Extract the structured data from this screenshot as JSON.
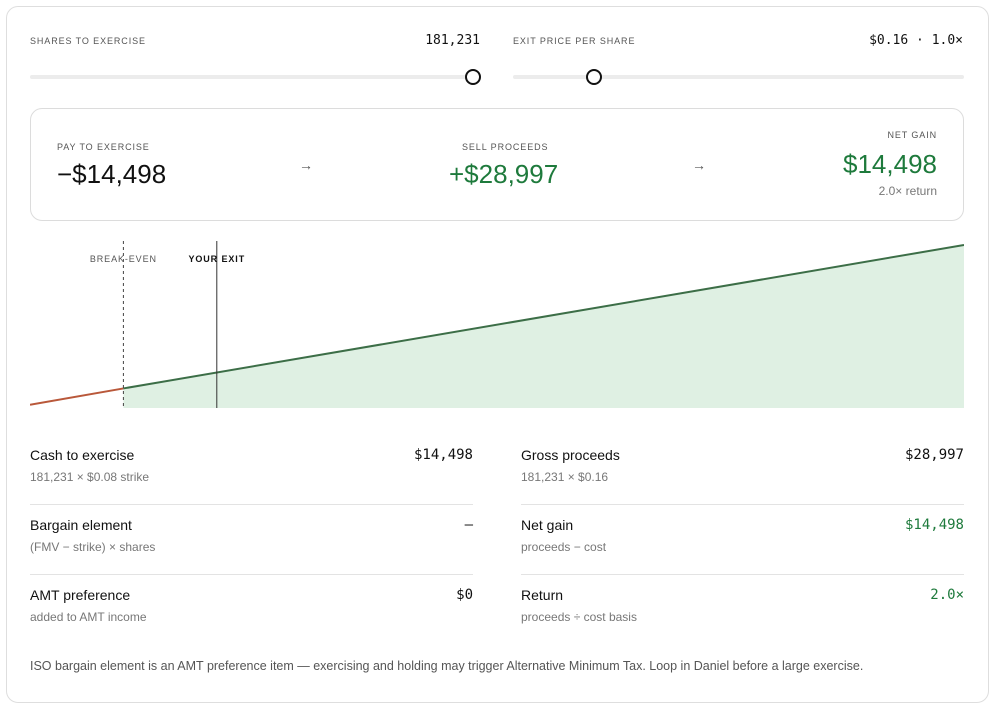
{
  "colors": {
    "accent_green": "#1e7a3c",
    "loss_red": "#b9583a",
    "area_fill": "#dff0e3",
    "line_green": "#3c6e47"
  },
  "sliders": {
    "shares": {
      "label": "SHARES TO EXERCISE",
      "value": "181,231",
      "fraction": 1.0
    },
    "exit_price": {
      "label": "EXIT PRICE PER SHARE",
      "value": "$0.16 · 1.0×",
      "fraction": 0.18
    }
  },
  "summary": {
    "pay": {
      "label": "PAY TO EXERCISE",
      "value": "−$14,498"
    },
    "sell": {
      "label": "SELL PROCEEDS",
      "value": "+$28,997"
    },
    "net": {
      "label": "NET GAIN",
      "value": "$14,498",
      "sub": "2.0× return"
    },
    "arrow_icon": "→"
  },
  "chart_data": {
    "type": "area",
    "xlim": [
      0,
      1
    ],
    "ylim": [
      0,
      1
    ],
    "series": [
      {
        "x": [
          0.0,
          0.1
        ],
        "y": [
          0.02,
          0.12
        ],
        "color": "#b9583a"
      },
      {
        "x": [
          0.1,
          1.0
        ],
        "y": [
          0.12,
          1.0
        ],
        "color": "#3c6e47"
      }
    ],
    "markers": [
      {
        "label": "BREAK-EVEN",
        "x": 0.1,
        "style": "dashed"
      },
      {
        "label": "YOUR EXIT",
        "x": 0.2,
        "style": "solid"
      }
    ]
  },
  "details": {
    "left": [
      {
        "title": "Cash to exercise",
        "sub": "181,231 × $0.08 strike",
        "value": "$14,498"
      },
      {
        "title": "Bargain element",
        "sub": "(FMV − strike) × shares",
        "value": "—"
      },
      {
        "title": "AMT preference",
        "sub": "added to AMT income",
        "value": "$0"
      }
    ],
    "right": [
      {
        "title": "Gross proceeds",
        "sub": "181,231 × $0.16",
        "value": "$28,997"
      },
      {
        "title": "Net gain",
        "sub": "proceeds − cost",
        "value": "$14,498"
      },
      {
        "title": "Return",
        "sub": "proceeds ÷ cost basis",
        "value": "2.0×"
      }
    ]
  },
  "footnote": "ISO bargain element is an AMT preference item — exercising and holding may trigger Alternative Minimum Tax. Loop in Daniel before a large exercise."
}
